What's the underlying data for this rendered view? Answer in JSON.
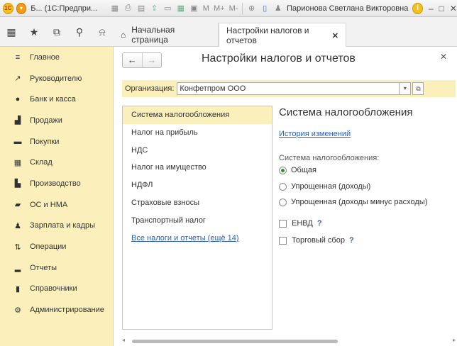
{
  "titlebar": {
    "logo_text": "1C",
    "title": "Б... (1С:Предпри...",
    "m_labels": [
      "M",
      "M+",
      "M-"
    ],
    "user": "Парионова Светлана Викторовна"
  },
  "tabs": {
    "home": "Начальная страница",
    "active": "Настройки налогов и отчетов"
  },
  "sidebar": {
    "items": [
      {
        "label": "Главное",
        "icon": "menu-lines-icon"
      },
      {
        "label": "Руководителю",
        "icon": "trend-chart-icon"
      },
      {
        "label": "Банк и касса",
        "icon": "coin-icon"
      },
      {
        "label": "Продажи",
        "icon": "shopping-bag-icon"
      },
      {
        "label": "Покупки",
        "icon": "cart-icon"
      },
      {
        "label": "Склад",
        "icon": "warehouse-icon"
      },
      {
        "label": "Производство",
        "icon": "factory-icon"
      },
      {
        "label": "ОС и НМА",
        "icon": "truck-icon"
      },
      {
        "label": "Зарплата и кадры",
        "icon": "person-icon"
      },
      {
        "label": "Операции",
        "icon": "operations-icon"
      },
      {
        "label": "Отчеты",
        "icon": "bar-chart-icon"
      },
      {
        "label": "Справочники",
        "icon": "book-icon"
      },
      {
        "label": "Администрирование",
        "icon": "gear-icon"
      }
    ]
  },
  "form": {
    "title": "Настройки налогов и отчетов",
    "org_label": "Организация:",
    "org_value": "Конфетпром ООО",
    "list": [
      "Система налогообложения",
      "Налог на прибыль",
      "НДС",
      "Налог на имущество",
      "НДФЛ",
      "Страховые взносы",
      "Транспортный налог"
    ],
    "list_link": "Все налоги и отчеты (ещё 14)",
    "panel_title": "Система налогообложения",
    "history_link": "История изменений",
    "tax_system_label": "Система налогообложения:",
    "radios": [
      {
        "label": "Общая",
        "checked": true
      },
      {
        "label": "Упрощенная (доходы)",
        "checked": false
      },
      {
        "label": "Упрощенная (доходы минус расходы)",
        "checked": false
      }
    ],
    "checks": [
      {
        "label": "ЕНВД",
        "help": "?"
      },
      {
        "label": "Торговый сбор",
        "help": "?"
      }
    ]
  }
}
